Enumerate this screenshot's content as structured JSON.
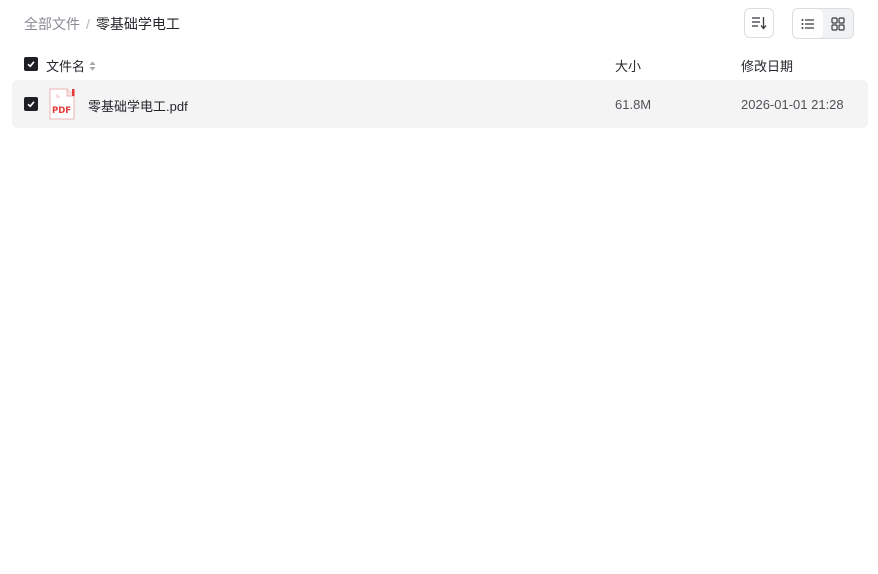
{
  "breadcrumb": {
    "root": "全部文件",
    "separator": "/",
    "current": "零基础学电工"
  },
  "toolbar": {
    "sort_icon": "sort-icon",
    "list_view_icon": "list-view-icon",
    "grid_view_icon": "grid-view-icon",
    "active_view": "list"
  },
  "table": {
    "header": {
      "name": "文件名",
      "size": "大小",
      "modified": "修改日期",
      "select_all_checked": true
    },
    "rows": [
      {
        "checked": true,
        "icon": "pdf-icon",
        "icon_label": "PDF",
        "name": "零基础学电工.pdf",
        "size": "61.8M",
        "modified": "2026-01-01 21:28"
      }
    ]
  },
  "colors": {
    "accent": "#1e1f24",
    "row_bg": "#f4f4f5",
    "pdf_red": "#e5383b"
  }
}
